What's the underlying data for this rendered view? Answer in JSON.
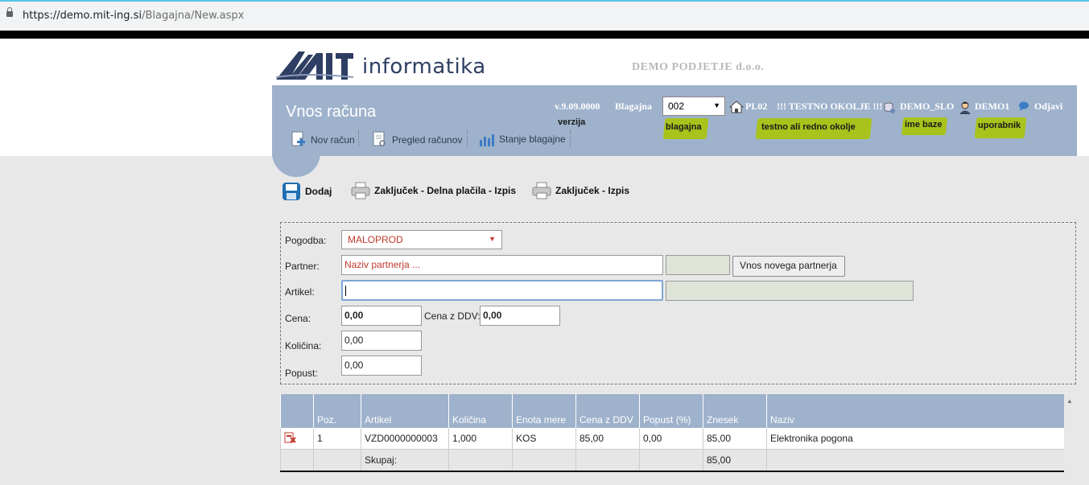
{
  "browser": {
    "url_host": "https://demo.mit-ing.si",
    "url_path": "/Blagajna/New.aspx"
  },
  "logo": {
    "word": "informatika"
  },
  "company_name": "DEMO PODJETJE d.o.o.",
  "header": {
    "title": "Vnos računa",
    "nav": [
      "Nov račun",
      "Pregled računov",
      "Stanje blagajne"
    ],
    "version": "v.9.09.0000",
    "blagajna_label": "Blagajna",
    "blagajna_value": "002",
    "location": "PL02",
    "env_text": "!!! TESTNO OKOLJE !!!",
    "db_name": "DEMO_SLO",
    "user": "DEMO1",
    "logout": "Odjavi"
  },
  "annotations": {
    "verzija": "verzija",
    "blagajna": "blagajna",
    "okolje": "testno ali redno okolje",
    "baza": "ime baze",
    "uporabnik": "uporabnik",
    "highlight_color": "#a8c31b"
  },
  "toolbar": {
    "dodaj": "Dodaj",
    "zakljucek_delna": "Zaključek - Delna plačila - Izpis",
    "zakljucek": "Zaključek - Izpis"
  },
  "form": {
    "pogodba_label": "Pogodba:",
    "pogodba_value": "MALOPROD",
    "partner_label": "Partner:",
    "partner_placeholder": "Naziv partnerja ...",
    "new_partner_button": "Vnos novega partnerja",
    "artikel_label": "Artikel:",
    "artikel_value": "",
    "cena_label": "Cena:",
    "cena_value": "0,00",
    "cena_ddv_label": "Cena z DDV:",
    "cena_ddv_value": "0,00",
    "kolicina_label": "Količina:",
    "kolicina_value": "0,00",
    "popust_label": "Popust:",
    "popust_value": "0,00"
  },
  "table": {
    "headers": [
      "",
      "Poz.",
      "Artikel",
      "Količina",
      "Enota mere",
      "Cena z DDV",
      "Popust (%)",
      "Znesek",
      "Naziv"
    ],
    "rows": [
      {
        "poz": "1",
        "artikel": "VZD0000000003",
        "kolicina": "1,000",
        "enota": "KOS",
        "cena": "85,00",
        "popust": "0,00",
        "znesek": "85,00",
        "naziv": "Elektronika pogona"
      }
    ],
    "sum_label": "Skupaj:",
    "sum_value": "85,00"
  }
}
